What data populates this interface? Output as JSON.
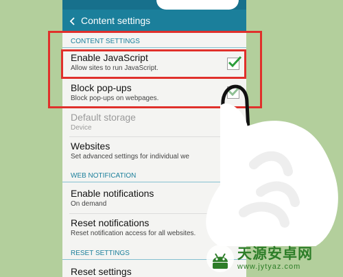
{
  "window": {
    "title": "Content settings"
  },
  "sections": [
    {
      "header": "CONTENT SETTINGS",
      "items": [
        {
          "title": "Enable JavaScript",
          "subtitle": "Allow sites to run JavaScript.",
          "checked": true
        },
        {
          "title": "Block pop-ups",
          "subtitle": "Block pop-ups on webpages.",
          "checked": true
        },
        {
          "title": "Default storage",
          "subtitle": "Device",
          "disabled": true
        },
        {
          "title": "Websites",
          "subtitle": "Set advanced settings for individual we"
        }
      ]
    },
    {
      "header": "WEB NOTIFICATION",
      "items": [
        {
          "title": "Enable notifications",
          "subtitle": "On demand"
        },
        {
          "title": "Reset notifications",
          "subtitle": "Reset notification access for all websites."
        }
      ]
    },
    {
      "header": "RESET SETTINGS",
      "items": [
        {
          "title": "Reset settings"
        }
      ]
    }
  ],
  "watermark": {
    "title": "天源安卓网",
    "url": "www.jytyaz.com"
  },
  "colors": {
    "accent": "#1b7f9b",
    "highlight": "#e0302b",
    "check": "#2a9d3a",
    "watermark": "#2d7d28"
  },
  "icons": {
    "back": "back-arrow-icon",
    "check": "checkmark-icon",
    "logo": "android-logo-icon"
  }
}
